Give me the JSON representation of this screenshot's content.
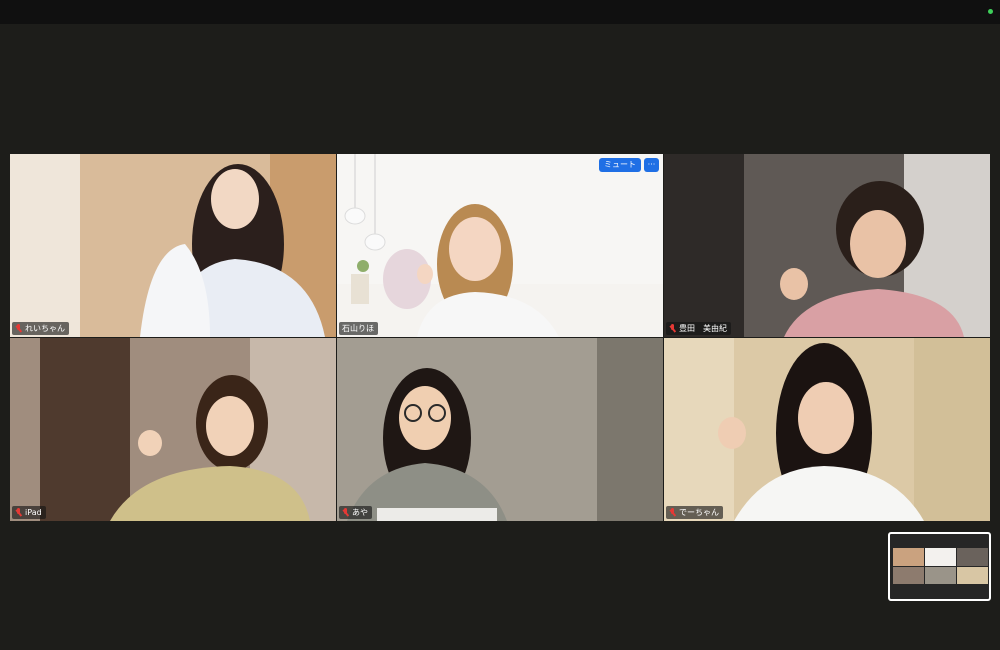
{
  "window": {
    "status": "connected"
  },
  "gallery": {
    "tiles": [
      {
        "name": "れいちゃん",
        "muted": true,
        "active": false,
        "bg": "#caa27f",
        "skin": "#f2d8c4",
        "hair": "#2b1f1c",
        "shirt": "#e9edf4"
      },
      {
        "name": "石山りほ",
        "muted": false,
        "active": true,
        "bg": "#f3f1ee",
        "skin": "#f4d6c2",
        "hair": "#b98a52",
        "shirt": "#f7f7f7"
      },
      {
        "name": "豊田　美由紀",
        "muted": true,
        "active": false,
        "bg": "#5a5450",
        "skin": "#e9c2a6",
        "hair": "#2a1f1a",
        "shirt": "#d9a0a4"
      },
      {
        "name": "iPad",
        "muted": true,
        "active": false,
        "bg": "#8d7b6e",
        "skin": "#f1d2b8",
        "hair": "#3a2518",
        "shirt": "#cfc08a"
      },
      {
        "name": "あや",
        "muted": true,
        "active": false,
        "bg": "#9a9489",
        "skin": "#f0cfb1",
        "hair": "#1f1714",
        "shirt": "#8e8f86"
      },
      {
        "name": "でーちゃん",
        "muted": true,
        "active": false,
        "bg": "#d8c6a4",
        "skin": "#efcdb3",
        "hair": "#1b1311",
        "shirt": "#f6f6f4"
      }
    ],
    "active_controls": {
      "mute_label": "ミュート",
      "more_label": "···"
    }
  },
  "self_view": {
    "label": "self-view-thumbnail"
  }
}
